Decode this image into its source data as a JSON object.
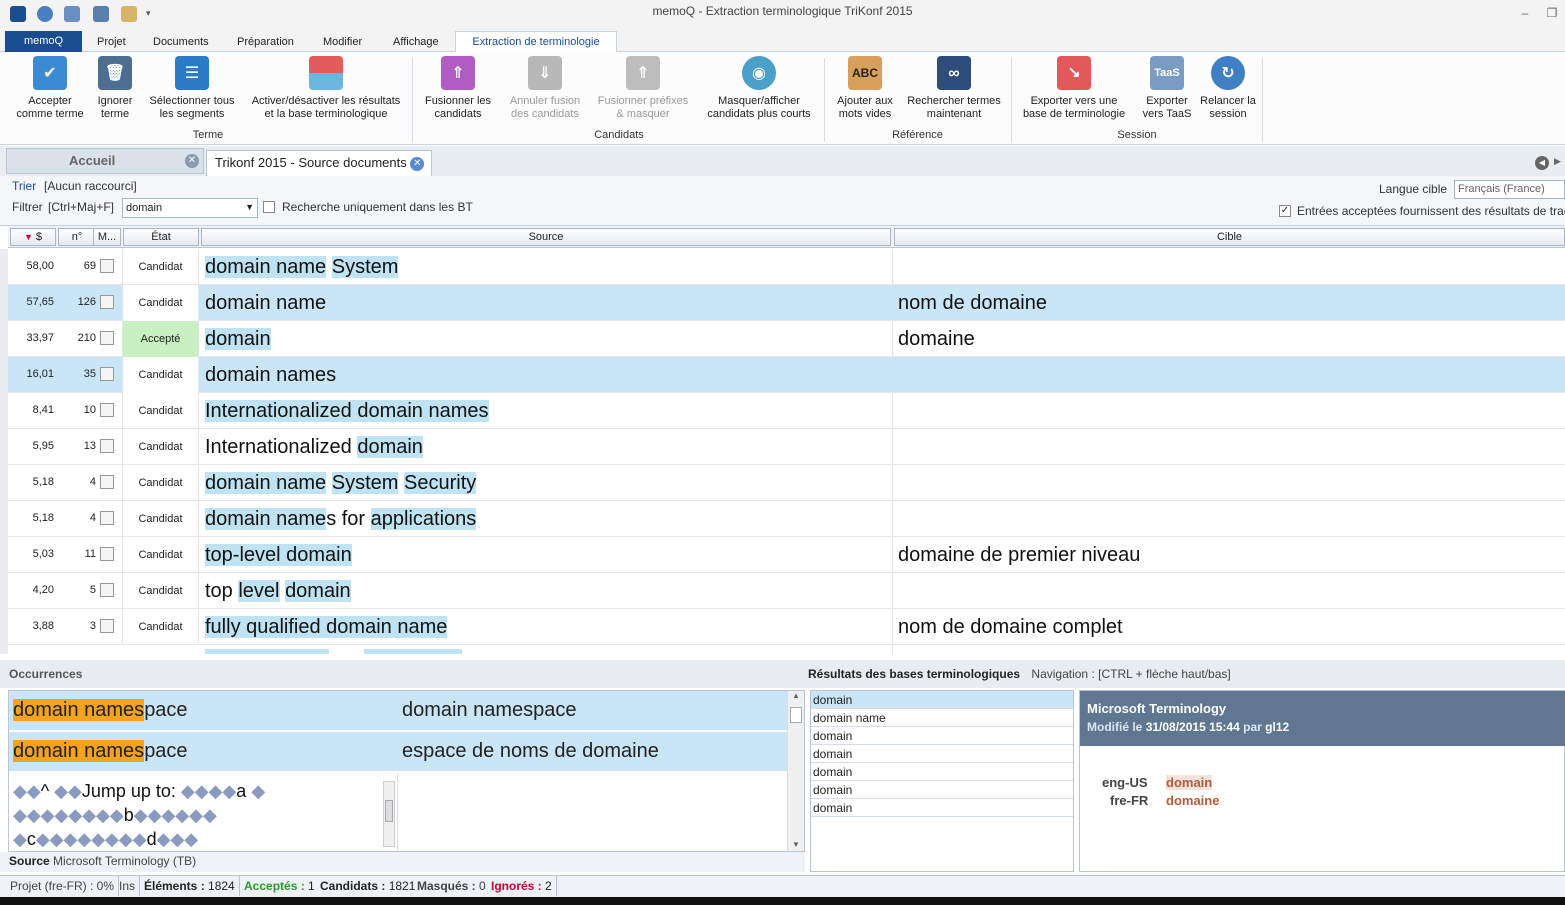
{
  "window": {
    "title": "memoQ - Extraction terminologique TriKonf 2015"
  },
  "menu": {
    "tabs": [
      "memoQ",
      "Projet",
      "Documents",
      "Préparation",
      "Modifier",
      "Affichage",
      "Extraction de terminologie"
    ]
  },
  "ribbon": {
    "buttons": [
      {
        "label": "Accepter comme terme",
        "icon": "accept-term-icon"
      },
      {
        "label": "Ignorer terme",
        "icon": "trash-icon"
      },
      {
        "label": "Sélectionner tous les segments",
        "icon": "select-segments-icon"
      },
      {
        "label": "Activer/désactiver les résultats et la base terminologique",
        "icon": "toggle-results-icon"
      },
      {
        "label": "Fusionner les candidats",
        "icon": "merge-icon"
      },
      {
        "label": "Annuler fusion des candidats",
        "icon": "unmerge-icon"
      },
      {
        "label": "Fusionner préfixes & masquer",
        "icon": "merge-prefix-icon"
      },
      {
        "label": "Masquer/afficher candidats plus courts",
        "icon": "eye-icon"
      },
      {
        "label": "Ajouter aux mots vides",
        "icon": "abc-hand-icon"
      },
      {
        "label": "Rechercher termes maintenant",
        "icon": "binoculars-icon"
      },
      {
        "label": "Exporter vers une base de terminologie",
        "icon": "export-tb-icon"
      },
      {
        "label": "Exporter vers TaaS",
        "icon": "taas-icon"
      },
      {
        "label": "Relancer la session",
        "icon": "restart-icon"
      }
    ],
    "groups": [
      "Terme",
      "Candidats",
      "Référence",
      "Session"
    ]
  },
  "doctabs": {
    "home": "Accueil",
    "current": "Trikonf 2015 - Source documents"
  },
  "filterbar": {
    "sort_label": "Trier",
    "sort_value": "[Aucun raccourci]",
    "filter_label": "Filtrer",
    "filter_shortcut": "[Ctrl+Maj+F]",
    "filter_value": "domain",
    "bt_only_label": "Recherche uniquement dans les BT",
    "target_lang_label": "Langue cible",
    "target_lang_value": "Français (France)",
    "accepted_entries_label": "Entrées acceptées fournissent des résultats de tradu"
  },
  "grid": {
    "headers": {
      "score": "$",
      "n": "n°",
      "m": "M...",
      "state": "État",
      "source": "Source",
      "target": "Cible"
    },
    "rows": [
      {
        "score": "58,00",
        "n": "69",
        "state": "Candidat",
        "source": "domain name System",
        "target": ""
      },
      {
        "score": "57,65",
        "n": "126",
        "state": "Candidat",
        "source": "domain name",
        "target": "nom de domaine"
      },
      {
        "score": "33,97",
        "n": "210",
        "state": "Accepté",
        "source": "domain",
        "target": "domaine"
      },
      {
        "score": "16,01",
        "n": "35",
        "state": "Candidat",
        "source": "domain names",
        "target": ""
      },
      {
        "score": "8,41",
        "n": "10",
        "state": "Candidat",
        "source": "Internationalized domain names",
        "target": ""
      },
      {
        "score": "5,95",
        "n": "13",
        "state": "Candidat",
        "source": "Internationalized domain",
        "target": ""
      },
      {
        "score": "5,18",
        "n": "4",
        "state": "Candidat",
        "source": "domain name System Security",
        "target": ""
      },
      {
        "score": "5,18",
        "n": "4",
        "state": "Candidat",
        "source": "domain names for applications",
        "target": ""
      },
      {
        "score": "5,03",
        "n": "11",
        "state": "Candidat",
        "source": "top-level domain",
        "target": "domaine de premier niveau"
      },
      {
        "score": "4,20",
        "n": "5",
        "state": "Candidat",
        "source": "top level domain",
        "target": ""
      },
      {
        "score": "3,88",
        "n": "3",
        "state": "Candidat",
        "source": "fully qualified domain name",
        "target": "nom de domaine complet"
      }
    ]
  },
  "occurrences": {
    "title": "Occurrences",
    "rows": [
      {
        "src_hl": "domain names",
        "src_rest": "pace",
        "tgt": "domain namespace"
      },
      {
        "src_hl": "domain names",
        "src_rest": "pace",
        "tgt": "espace de noms de domaine"
      }
    ],
    "jump_text": "Jump up to:",
    "letters": [
      "a",
      "b",
      "c",
      "d"
    ],
    "source_label": "Source",
    "source_value": "Microsoft Terminology (TB)"
  },
  "tb": {
    "title": "Résultats des bases terminologiques",
    "nav": "Navigation : [CTRL + flèche haut/bas]",
    "items": [
      "domain",
      "domain name",
      "domain",
      "domain",
      "domain",
      "domain",
      "domain"
    ],
    "detail_title": "Microsoft Terminology",
    "detail_modified_prefix": "Modifié le",
    "detail_modified": "31/08/2015 15:44",
    "detail_by_prefix": "par",
    "detail_by": "gl12",
    "entries": [
      {
        "lang": "eng-US",
        "term": "domain"
      },
      {
        "lang": "fre-FR",
        "term": "domaine"
      }
    ]
  },
  "status": {
    "project": "Projet (fre-FR) : 0%",
    "mode": "Ins",
    "elements_label": "Éléments :",
    "elements_value": "1824",
    "accepted_label": "Acceptés :",
    "accepted_value": "1",
    "candidates_label": "Candidats :",
    "candidates_value": "1821",
    "hidden_label": "Masqués :",
    "hidden_value": "0",
    "ignored_label": "Ignorés :",
    "ignored_value": "2"
  },
  "colors": {
    "brand": "#1a4d8f",
    "selected_row": "#c9e5f6",
    "accepted": "#c8f0c0",
    "occurrence_hl": "#f4a21f",
    "tb_term": "#b35c38"
  }
}
